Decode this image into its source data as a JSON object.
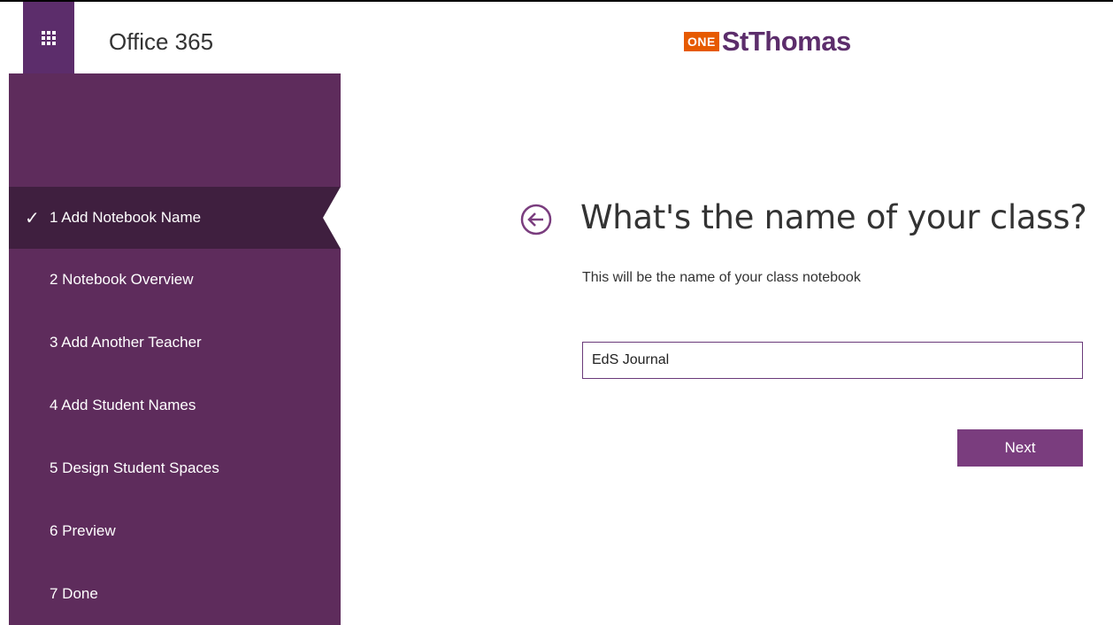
{
  "header": {
    "app_title": "Office 365",
    "logo_badge": "ONE",
    "logo_name": "StThomas",
    "waffle_icon": "app-launcher-icon"
  },
  "sidebar": {
    "items": [
      {
        "label": "1  Add Notebook Name",
        "active": true,
        "completed": true
      },
      {
        "label": "2  Notebook Overview",
        "active": false
      },
      {
        "label": "3  Add Another Teacher",
        "active": false
      },
      {
        "label": "4  Add Student Names",
        "active": false
      },
      {
        "label": "5  Design Student Spaces",
        "active": false
      },
      {
        "label": "6  Preview",
        "active": false
      },
      {
        "label": "7  Done",
        "active": false
      }
    ],
    "check_glyph": "✓"
  },
  "main": {
    "back_icon": "back-arrow-icon",
    "headline": "What's the name of your class?",
    "subtext": "This will be the name of your class notebook",
    "class_name_value": "EdS Journal",
    "next_label": "Next"
  },
  "colors": {
    "sidebar": "#5e2c5c",
    "sidebar_active": "#3f1f3f",
    "waffle": "#5c2d6b",
    "logo_orange": "#e65a00",
    "logo_purple": "#5c2d6b",
    "button": "#7a3d7e"
  }
}
